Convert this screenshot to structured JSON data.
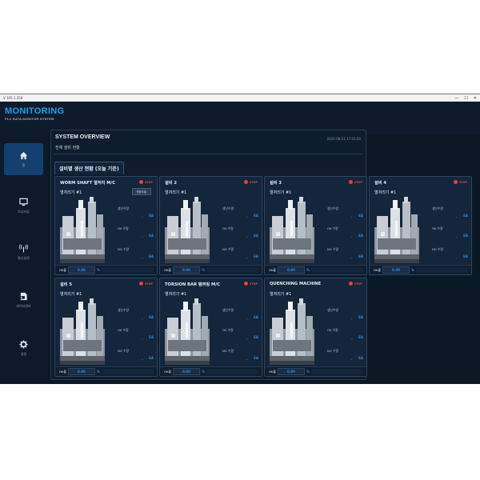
{
  "window": {
    "title": "V 105.1.356",
    "controls": [
      "—",
      "☐",
      "✕"
    ]
  },
  "app": {
    "title": "MONITORING",
    "subtitle": "PLC DATA MONITOR SYSTEM"
  },
  "sidebar": {
    "items": [
      {
        "icon": "home-icon",
        "label": "홈"
      },
      {
        "icon": "monitor-icon",
        "label": "모니터링"
      },
      {
        "icon": "antenna-icon",
        "label": "통신설정"
      },
      {
        "icon": "excel-icon",
        "label": "데이터관리"
      },
      {
        "icon": "gear-icon",
        "label": "설정"
      }
    ]
  },
  "overview": {
    "title": "SYSTEM OVERVIEW",
    "subtitle": "전체 설비 현황",
    "datetime": "2026-08-21 17:03:00",
    "tab": "설비별 생산 현황 (오늘 기준)"
  },
  "cards": [
    {
      "name": "WORM SHAFT 열처리 M/C",
      "type": "열처리기 #1",
      "status": "STOP",
      "button": "현황추출",
      "stats": [
        {
          "label": "생산수량",
          "value": "-",
          "unit": "EA"
        },
        {
          "label": "OK 수량",
          "value": "-",
          "unit": "EA"
        },
        {
          "label": "NG 수량",
          "value": "-",
          "unit": "EA"
        }
      ],
      "ok_label": "OK율",
      "ok_rate": "0.00",
      "ok_unit": "%"
    },
    {
      "name": "설비 2",
      "type": "열처리기 #1",
      "status": "STOP",
      "stats": [
        {
          "label": "생산수량",
          "value": "-",
          "unit": "EA"
        },
        {
          "label": "OK 수량",
          "value": "-",
          "unit": "EA"
        },
        {
          "label": "NG 수량",
          "value": "-",
          "unit": "EA"
        }
      ],
      "ok_label": "OK율",
      "ok_rate": "0.00",
      "ok_unit": "%"
    },
    {
      "name": "설비 3",
      "type": "열처리기 #1",
      "status": "STOP",
      "stats": [
        {
          "label": "생산수량",
          "value": "-",
          "unit": "EA"
        },
        {
          "label": "OK 수량",
          "value": "-",
          "unit": "EA"
        },
        {
          "label": "NG 수량",
          "value": "-",
          "unit": "EA"
        }
      ],
      "ok_label": "OK율",
      "ok_rate": "0.00",
      "ok_unit": "%"
    },
    {
      "name": "설비 4",
      "type": "열처리기 #1",
      "status": "STOP",
      "stats": [
        {
          "label": "생산수량",
          "value": "-",
          "unit": "EA"
        },
        {
          "label": "OK 수량",
          "value": "-",
          "unit": "EA"
        },
        {
          "label": "NG 수량",
          "value": "-",
          "unit": "EA"
        }
      ],
      "ok_label": "OK율",
      "ok_rate": "0.00",
      "ok_unit": "%"
    },
    {
      "name": "설비 5",
      "type": "열처리기 #1",
      "status": "STOP",
      "stats": [
        {
          "label": "생산수량",
          "value": "-",
          "unit": "EA"
        },
        {
          "label": "OK 수량",
          "value": "-",
          "unit": "EA"
        },
        {
          "label": "NG 수량",
          "value": "-",
          "unit": "EA"
        }
      ],
      "ok_label": "OK율",
      "ok_rate": "0.00",
      "ok_unit": "%"
    },
    {
      "name": "TORSION BAR 템퍼링 M/C",
      "type": "열처리기 #1",
      "status": "STOP",
      "stats": [
        {
          "label": "생산수량",
          "value": "-",
          "unit": "EA"
        },
        {
          "label": "OK 수량",
          "value": "-",
          "unit": "EA"
        },
        {
          "label": "NG 수량",
          "value": "-",
          "unit": "EA"
        }
      ],
      "ok_label": "OK율",
      "ok_rate": "0.00",
      "ok_unit": "%"
    },
    {
      "name": "QUENCHING MACHINE",
      "type": "열처리기 #1",
      "status": "STOP",
      "stats": [
        {
          "label": "생산수량",
          "value": "-",
          "unit": "EA"
        },
        {
          "label": "OK 수량",
          "value": "-",
          "unit": "EA"
        },
        {
          "label": "NG 수량",
          "value": "-",
          "unit": "EA"
        }
      ],
      "ok_label": "OK율",
      "ok_rate": "0.00",
      "ok_unit": "%"
    }
  ],
  "colors": {
    "accent": "#1aa3ef",
    "stop": "#e0453b",
    "unit": "#2d8ae6",
    "background": "#0b1826"
  }
}
